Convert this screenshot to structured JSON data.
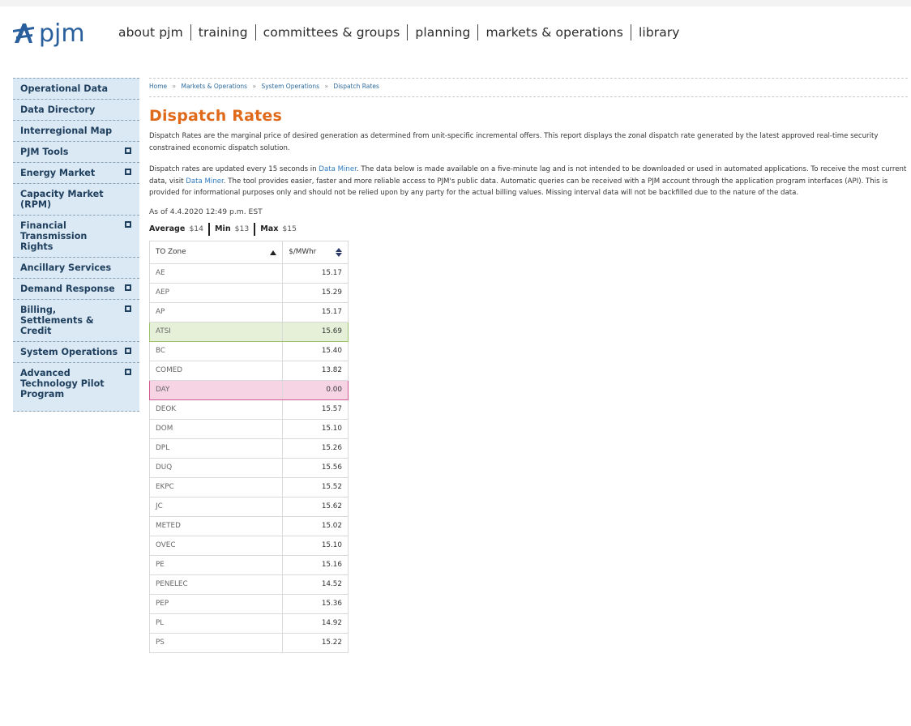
{
  "header": {
    "logo_text": "pjm",
    "nav": [
      "about pjm",
      "training",
      "committees & groups",
      "planning",
      "markets & operations",
      "library"
    ]
  },
  "sidebar": {
    "items": [
      {
        "label": "Operational Data",
        "expandable": false
      },
      {
        "label": "Data Directory",
        "expandable": false
      },
      {
        "label": "Interregional Map",
        "expandable": false
      },
      {
        "label": "PJM Tools",
        "expandable": true
      },
      {
        "label": "Energy Market",
        "expandable": true
      },
      {
        "label": "Capacity Market (RPM)",
        "expandable": false
      },
      {
        "label": "Financial Transmission Rights",
        "expandable": true
      },
      {
        "label": "Ancillary Services",
        "expandable": false
      },
      {
        "label": "Demand Response",
        "expandable": true
      },
      {
        "label": "Billing, Settlements & Credit",
        "expandable": true
      },
      {
        "label": "System Operations",
        "expandable": true
      },
      {
        "label": "Advanced Technology Pilot Program",
        "expandable": true
      }
    ]
  },
  "breadcrumb": [
    "Home",
    "Markets & Operations",
    "System Operations",
    "Dispatch Rates"
  ],
  "breadcrumb_separator": "»",
  "page": {
    "title": "Dispatch Rates",
    "intro": "Dispatch Rates are the marginal price of desired generation as determined from unit-specific incremental offers. This report displays the zonal dispatch rate generated by the latest approved real-time security constrained economic dispatch solution.",
    "p2_a": "Dispatch rates are updated every 15 seconds in ",
    "p2_link1": "Data Miner",
    "p2_b": ". The data below is made available on a five-minute lag and is not intended to be downloaded or used in automated applications. To receive the most current data, visit ",
    "p2_link2": "Data Miner",
    "p2_c": ". The tool provides easier, faster and more reliable access to PJM's public data. Automatic queries can be received with a PJM account through the application program interfaces (API). This is provided for informational purposes only and should not be relied upon by any party for the actual billing values. Missing interval data will not be backfilled due to the nature of the data.",
    "as_of": "As of 4.4.2020 12:49 p.m. EST"
  },
  "stats": {
    "average_label": "Average",
    "average_value": "$14",
    "min_label": "Min",
    "min_value": "$13",
    "max_label": "Max",
    "max_value": "$15"
  },
  "table": {
    "col_zone": "TO Zone",
    "col_rate": "$/MWhr",
    "rows": [
      {
        "zone": "AE",
        "rate": "15.17",
        "highlight": ""
      },
      {
        "zone": "AEP",
        "rate": "15.29",
        "highlight": ""
      },
      {
        "zone": "AP",
        "rate": "15.17",
        "highlight": ""
      },
      {
        "zone": "ATSI",
        "rate": "15.69",
        "highlight": "green"
      },
      {
        "zone": "BC",
        "rate": "15.40",
        "highlight": ""
      },
      {
        "zone": "COMED",
        "rate": "13.82",
        "highlight": ""
      },
      {
        "zone": "DAY",
        "rate": "0.00",
        "highlight": "pink"
      },
      {
        "zone": "DEOK",
        "rate": "15.57",
        "highlight": ""
      },
      {
        "zone": "DOM",
        "rate": "15.10",
        "highlight": ""
      },
      {
        "zone": "DPL",
        "rate": "15.26",
        "highlight": ""
      },
      {
        "zone": "DUQ",
        "rate": "15.56",
        "highlight": ""
      },
      {
        "zone": "EKPC",
        "rate": "15.52",
        "highlight": ""
      },
      {
        "zone": "JC",
        "rate": "15.62",
        "highlight": ""
      },
      {
        "zone": "METED",
        "rate": "15.02",
        "highlight": ""
      },
      {
        "zone": "OVEC",
        "rate": "15.10",
        "highlight": ""
      },
      {
        "zone": "PE",
        "rate": "15.16",
        "highlight": ""
      },
      {
        "zone": "PENELEC",
        "rate": "14.52",
        "highlight": ""
      },
      {
        "zone": "PEP",
        "rate": "15.36",
        "highlight": ""
      },
      {
        "zone": "PL",
        "rate": "14.92",
        "highlight": ""
      },
      {
        "zone": "PS",
        "rate": "15.22",
        "highlight": ""
      }
    ]
  },
  "colors": {
    "title": "#e06a1b",
    "link": "#2e7bbf",
    "sidebar_bg": "#dbe9f4",
    "logo_blue": "#2a5f9e",
    "highlight_green": "#e6efd8",
    "highlight_pink": "#f6d4e3"
  }
}
